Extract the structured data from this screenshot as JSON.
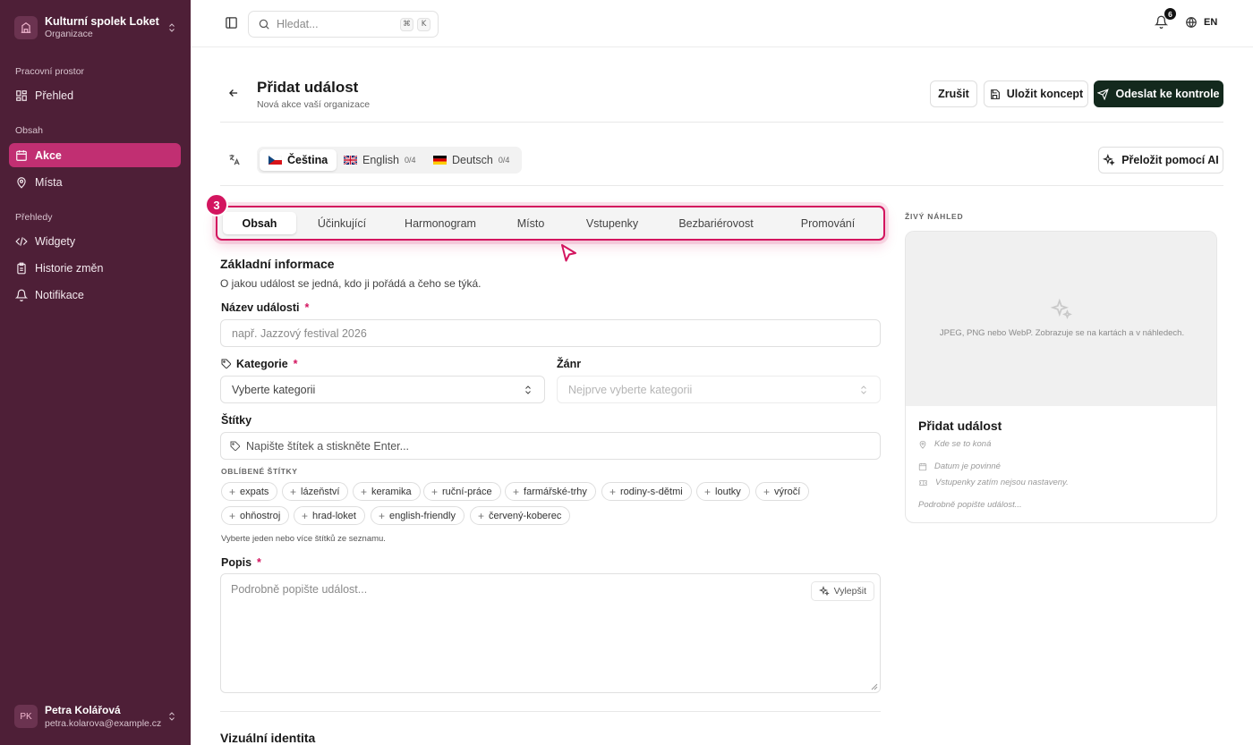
{
  "sidebar": {
    "org_name": "Kulturní spolek Loket",
    "org_type": "Organizace",
    "sections": [
      "Pracovní prostor",
      "Obsah",
      "Přehledy"
    ],
    "items": [
      {
        "label": "Přehled",
        "icon": "grid-icon"
      },
      {
        "label": "Akce",
        "icon": "calendar-icon",
        "active": true
      },
      {
        "label": "Místa",
        "icon": "map-pin-icon"
      },
      {
        "label": "Widgety",
        "icon": "code-icon"
      },
      {
        "label": "Historie změn",
        "icon": "clipboard-icon"
      },
      {
        "label": "Notifikace",
        "icon": "bell-icon"
      }
    ],
    "user": {
      "initials": "PK",
      "name": "Petra Kolářová",
      "email": "petra.kolarova@example.cz"
    }
  },
  "topbar": {
    "search_placeholder": "Hledat...",
    "shortcut_mod": "⌘",
    "shortcut_key": "K",
    "notification_count": "6",
    "language": "EN"
  },
  "header": {
    "title": "Přidat událost",
    "subtitle": "Nová akce vaší organizace",
    "cancel": "Zrušit",
    "save_draft": "Uložit koncept",
    "submit": "Odeslat ke kontrole"
  },
  "languages": {
    "tabs": [
      {
        "label": "Čeština",
        "count": ""
      },
      {
        "label": "English",
        "count": "0/4"
      },
      {
        "label": "Deutsch",
        "count": "0/4"
      }
    ],
    "translate_ai": "Přeložit pomocí AI"
  },
  "step": "3",
  "content_tabs": [
    "Obsah",
    "Účinkující",
    "Harmonogram",
    "Místo",
    "Vstupenky",
    "Bezbariérovost",
    "Promování"
  ],
  "form": {
    "section_title": "Základní informace",
    "section_desc": "O jakou událost se jedná, kdo ji pořádá a čeho se týká.",
    "name_label": "Název události",
    "name_placeholder": "např. Jazzový festival 2026",
    "category_label": "Kategorie",
    "category_placeholder": "Vyberte kategorii",
    "genre_label": "Žánr",
    "genre_placeholder": "Nejprve vyberte kategorii",
    "tags_label": "Štítky",
    "tags_placeholder": "Napište štítek a stiskněte Enter...",
    "favorite_tags_caption": "OBLÍBENÉ ŠTÍTKY",
    "favorite_tags": [
      "expats",
      "lázeňství",
      "keramika",
      "ruční-práce",
      "farmářské-trhy",
      "rodiny-s-dětmi",
      "loutky",
      "výročí",
      "ohňostroj",
      "hrad-loket",
      "english-friendly",
      "červený-koberec"
    ],
    "tags_hint": "Vyberte jeden nebo více štítků ze seznamu.",
    "description_label": "Popis",
    "description_placeholder": "Podrobně popište událost...",
    "improve_button": "Vylepšit",
    "required_mark": "*",
    "visual_identity_title": "Vizuální identita"
  },
  "preview": {
    "caption": "ŽIVÝ NÁHLED",
    "image_hint": "JPEG, PNG nebo WebP. Zobrazuje se na kartách a v náhledech.",
    "title": "Přidat událost",
    "location": "Kde se to koná",
    "date": "Datum je povinné",
    "tickets": "Vstupenky zatím nejsou nastaveny.",
    "description": "Podrobně popište událost..."
  },
  "colors": {
    "sidebar_bg": "#4e1f37",
    "accent": "#c12f72",
    "highlight": "#d3155f",
    "primary_button": "#13291d"
  }
}
